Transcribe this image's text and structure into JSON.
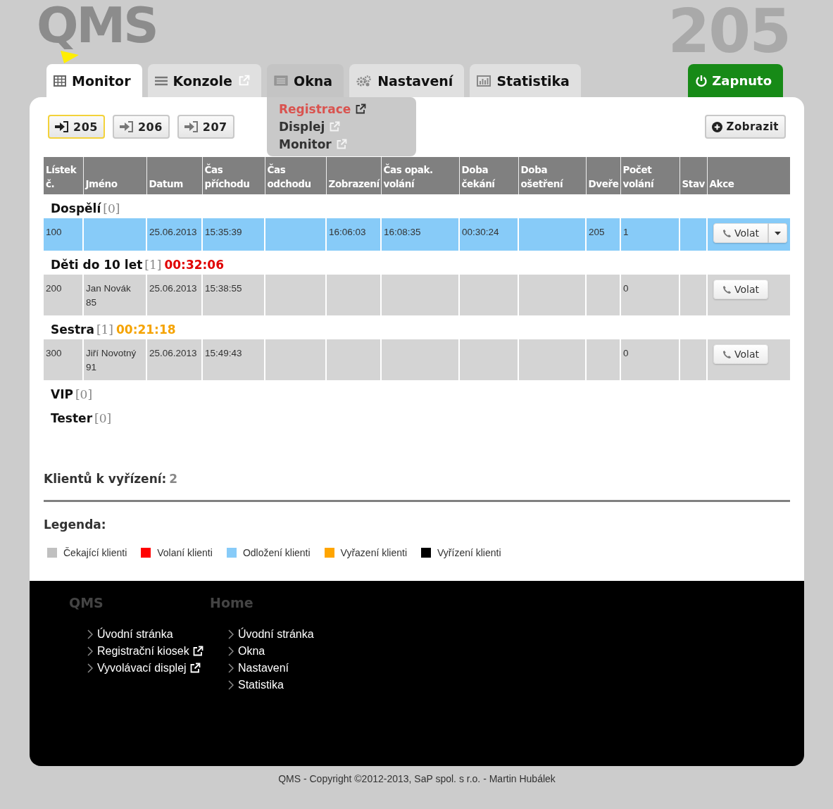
{
  "header": {
    "logo": "QMS",
    "counter": "205"
  },
  "tabs": [
    {
      "label": "Monitor",
      "selected": true,
      "expanded": false,
      "external": false
    },
    {
      "label": "Konzole",
      "selected": false,
      "expanded": false,
      "external": true
    },
    {
      "label": "Okna",
      "selected": false,
      "expanded": true,
      "external": false
    },
    {
      "label": "Nastavení",
      "selected": false,
      "expanded": false,
      "external": false
    },
    {
      "label": "Statistika",
      "selected": false,
      "expanded": false,
      "external": false
    }
  ],
  "power_button": {
    "label": "Zapnuto",
    "on": true
  },
  "okna_menu": [
    {
      "label": "Registrace",
      "highlighted": true,
      "external": true
    },
    {
      "label": "Displej",
      "highlighted": false,
      "external": true
    },
    {
      "label": "Monitor",
      "highlighted": false,
      "external": true
    }
  ],
  "counters": [
    {
      "label": "205",
      "selected": true
    },
    {
      "label": "206",
      "selected": false
    },
    {
      "label": "207",
      "selected": false
    }
  ],
  "show_button": "Zobrazit",
  "table": {
    "columns": [
      "Lístek č.",
      "Jméno",
      "Datum",
      "Čas příchodu",
      "Čas odchodu",
      "Zobrazení",
      "Čas opak. volání",
      "Doba čekání",
      "Doba ošetření",
      "Dveře",
      "Počet volání",
      "Stav",
      "Akce"
    ],
    "groups": [
      {
        "name": "Dospělí",
        "count": "[0]",
        "rows": [
          {
            "postponed": true,
            "cells": [
              "100",
              null,
              "25.06.2013",
              "15:35:39",
              null,
              "16:06:03",
              "16:08:35",
              "00:30:24",
              null,
              "205",
              "1",
              null
            ],
            "action": {
              "label": "Volat",
              "menu": true
            }
          }
        ]
      },
      {
        "name": "Děti do 10 let",
        "count": "[1]",
        "timer": {
          "text": "00:32:06",
          "color": "#e00000"
        },
        "rows": [
          {
            "postponed": false,
            "cells": [
              "200",
              "Jan Novák 85",
              "25.06.2013",
              "15:38:55",
              null,
              null,
              null,
              null,
              null,
              null,
              "0",
              null
            ],
            "action": {
              "label": "Volat",
              "menu": false
            }
          }
        ]
      },
      {
        "name": "Sestra",
        "count": "[1]",
        "timer": {
          "text": "00:21:18",
          "color": "#f5a300"
        },
        "rows": [
          {
            "postponed": false,
            "cells": [
              "300",
              "Jiří Novotný 91",
              "25.06.2013",
              "15:49:43",
              null,
              null,
              null,
              null,
              null,
              null,
              "0",
              null
            ],
            "action": {
              "label": "Volat",
              "menu": false
            }
          }
        ]
      },
      {
        "name": "VIP",
        "count": "[0]"
      },
      {
        "name": "Tester",
        "count": "[0]"
      }
    ]
  },
  "summary": {
    "label": "Klientů k vyřízení:",
    "value": "2"
  },
  "legend": {
    "title": "Legenda:",
    "items": [
      {
        "label": "Čekající klienti",
        "color": "#c0c0c0"
      },
      {
        "label": "Volaní klienti",
        "color": "#ff0000"
      },
      {
        "label": "Odložení klienti",
        "color": "#87cbf8"
      },
      {
        "label": "Vyřazení klienti",
        "color": "#ffa500"
      },
      {
        "label": "Vyřízení klienti",
        "color": "#000000"
      }
    ]
  },
  "footer": {
    "columns": [
      {
        "title": "QMS",
        "links": [
          {
            "label": "Úvodní stránka",
            "external": false
          },
          {
            "label": "Registrační kiosek",
            "external": true
          },
          {
            "label": "Vyvolávací displej",
            "external": true
          }
        ]
      },
      {
        "title": "Home",
        "links": [
          {
            "label": "Úvodní stránka",
            "external": false
          },
          {
            "label": "Okna",
            "external": false
          },
          {
            "label": "Nastavení",
            "external": false
          },
          {
            "label": "Statistika",
            "external": false
          }
        ]
      }
    ],
    "copyright": "QMS - Copyright ©2012-2013, SaP spol. s r.o. - Martin Hubálek"
  }
}
